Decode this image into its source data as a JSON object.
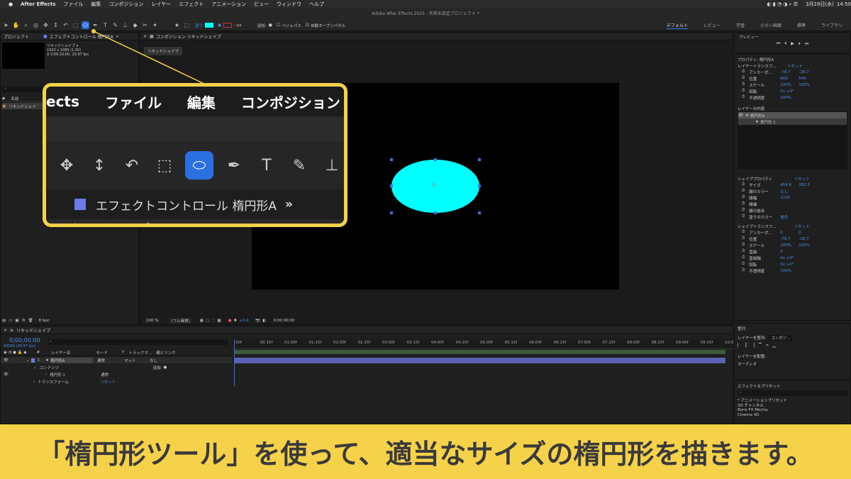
{
  "menubar": {
    "apple": "",
    "app": "After Effects",
    "items": [
      "ファイル",
      "編集",
      "コンポジション",
      "レイヤー",
      "エフェクト",
      "アニメーション",
      "ビュー",
      "ウィンドウ",
      "ヘルプ"
    ],
    "date": "3月19日(水)",
    "time": "14:50"
  },
  "window_title": "Adobe After Effects 2025 - 名称未設定プロジェクト *",
  "toolbar": {
    "fill_label": "塗り",
    "stroke_unit": "- px",
    "add_label": "追加:",
    "bezier_label": "ベジェパス",
    "auto_open_label": "自動オープンパネル"
  },
  "workspaces": [
    "デフォルト",
    "レビュー",
    "学習",
    "小さい画面",
    "標準",
    "ライブラリ"
  ],
  "project": {
    "tab": "プロジェクト",
    "effect_tab": "エフェクトコントロール 楕円形A",
    "comp_name": "リキッドシェイプ ▾",
    "comp_size": "1920 x 1080 (1.00)",
    "comp_duration": "Δ 0;00;10;00, 29.97 fps",
    "search_placeholder": "",
    "name_col": "名前",
    "item": "リキッドシェイ",
    "bpc": "8 bpc"
  },
  "composition": {
    "tab": "コンポジション リキッドシェイプ",
    "subtab": "リキッドシェイプ",
    "zoom": "100 %",
    "quality": "(フル画質)",
    "offset": "+0.0",
    "timecode": "0;00;00;00"
  },
  "zoom_callout": {
    "menu": [
      "ects",
      "ファイル",
      "編集",
      "コンポジション"
    ],
    "tools": [
      "✥",
      "↕",
      "↶",
      "⬚",
      "⬭",
      "✒",
      "T",
      "✎",
      "⊥"
    ],
    "effect_label": "エフェクトコントロール 楕円形A",
    "effect_more": "»",
    "bottom_text": "リキッドシェイプ"
  },
  "preview": {
    "title": "プレビュー"
  },
  "properties": {
    "title": "プロパティ: 楕円形A",
    "layer_transform": "レイヤートランスフ...",
    "reset": "リセット",
    "rows": [
      {
        "label": "アンカーポ...",
        "v1": "-78.7",
        "v2": "-28.7"
      },
      {
        "label": "位置",
        "v1": "960",
        "v2": "540"
      },
      {
        "label": "スケール",
        "v1": "100%",
        "v2": "100%"
      },
      {
        "label": "回転",
        "v1": "0x +0°",
        "v2": ""
      },
      {
        "label": "不透明度",
        "v1": "100%",
        "v2": ""
      }
    ],
    "layer_contents": "レイヤーの内容",
    "contents": [
      "楕円形A",
      "楕円形 1"
    ],
    "shape_props": "シェイププロパティ",
    "shape_rows": [
      {
        "label": "サイズ",
        "v1": "454.6",
        "v2": "282.5"
      },
      {
        "label": "線のカラー",
        "v1": "なし",
        "v2": ""
      },
      {
        "label": "線幅",
        "v1": "2200",
        "v2": ""
      },
      {
        "label": "線端",
        "v1": "",
        "v2": ""
      },
      {
        "label": "線の結合",
        "v1": "",
        "v2": ""
      },
      {
        "label": "塗りのカラー",
        "v1": "単色",
        "v2": ""
      }
    ],
    "shape_transform": "シェイプトランスフ...",
    "st_rows": [
      {
        "label": "アンカーポ...",
        "v1": "0",
        "v2": "0"
      },
      {
        "label": "位置",
        "v1": "-78.7",
        "v2": "-28.7"
      },
      {
        "label": "スケール",
        "v1": "100%",
        "v2": "100%"
      },
      {
        "label": "歪曲",
        "v1": "0",
        "v2": ""
      },
      {
        "label": "歪曲軸",
        "v1": "0x +0°",
        "v2": ""
      },
      {
        "label": "回転",
        "v1": "0x +0°",
        "v2": ""
      },
      {
        "label": "不透明度",
        "v1": "100%",
        "v2": ""
      }
    ]
  },
  "align": {
    "title": "整列",
    "align_to_label": "レイヤーを整列:",
    "align_to": "コンポジ...",
    "distribute": "レイヤーを配置:",
    "audio": "オーディオ"
  },
  "effects": {
    "title": "エフェクト＆プリセット",
    "search_placeholder": "",
    "items": [
      "* アニメーションプリセット",
      "3D チャンネル",
      "Boris FX Mocha",
      "Cinema 4D"
    ]
  },
  "timeline": {
    "tab": "リキッドシェイプ",
    "timecode": "0;00;00;00",
    "fps": "00000 (29.97 fps)",
    "cols": [
      "#",
      "レイヤー名",
      "モード",
      "T",
      "トラックマ...",
      "親とリンク"
    ],
    "layer": {
      "num": "1",
      "name": "楕円形A",
      "mode": "通常",
      "matte": "マット",
      "parent": "なし"
    },
    "contents": "コンテンツ",
    "add": "追加:",
    "sub": "楕円形 1",
    "sub_mode": "通常",
    "transform": "トランスフォーム",
    "reset": "リセット",
    "ticks": [
      "00f",
      "00:15f",
      "01:00f",
      "01:15f",
      "02:00f",
      "02:15f",
      "03:00f",
      "03:15f",
      "04:00f",
      "04:15f",
      "05:00f",
      "05:15f",
      "06:00f",
      "06:15f",
      "07:00f",
      "07:15f",
      "08:00f",
      "08:15f",
      "09:00f",
      "09:15f",
      "10:0"
    ]
  },
  "caption": "「楕円形ツール」を使って、適当なサイズの楕円形を描きます。",
  "colors": {
    "accent": "#2b6fe0",
    "cyan": "#00ffff",
    "highlight": "#f5d24a"
  }
}
